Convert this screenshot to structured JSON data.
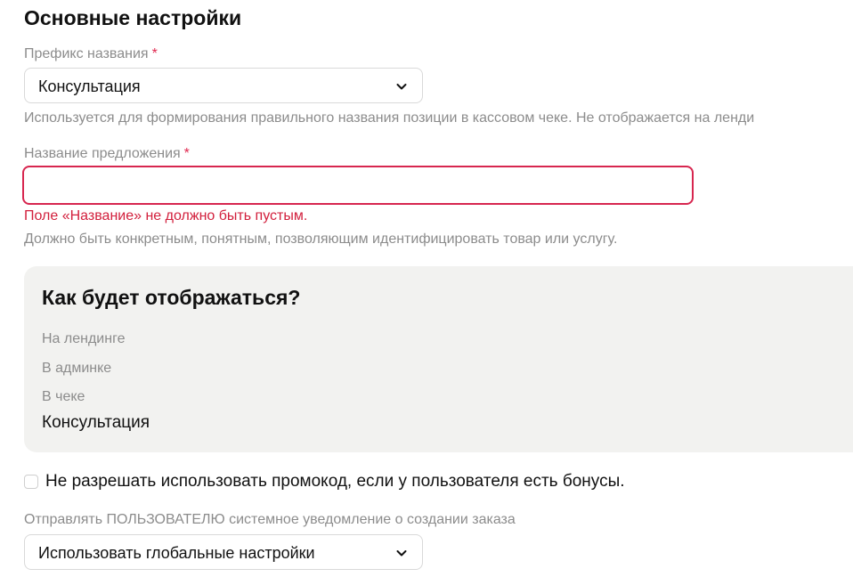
{
  "section": {
    "title": "Основные настройки"
  },
  "prefix_field": {
    "label": "Префикс названия",
    "required_mark": "*",
    "value": "Консультация",
    "hint": "Используется для формирования правильного названия позиции в кассовом чеке. Не отображается на ленди"
  },
  "name_field": {
    "label": "Название предложения",
    "required_mark": "*",
    "value": "",
    "placeholder": "",
    "error": "Поле «Название» не должно быть пустым.",
    "hint": "Должно быть конкретным, понятным, позволяющим идентифицировать товар или услугу."
  },
  "preview": {
    "title": "Как будет отображаться?",
    "landing_label": "На лендинге",
    "admin_label": "В админке",
    "receipt_label": "В чеке",
    "receipt_value": "Консультация"
  },
  "promo_checkbox": {
    "label": "Не разрешать использовать промокод, если у пользователя есть бонусы.",
    "checked": false
  },
  "notification_field": {
    "label": "Отправлять ПОЛЬЗОВАТЕЛЮ системное уведомление о создании заказа",
    "value": "Использовать глобальные настройки"
  },
  "icons": {
    "dropdown": "chevron-down-icon"
  },
  "colors": {
    "error": "#d21f3c",
    "required": "#e0284f",
    "panel_bg": "#f2f2f0",
    "muted_text": "#8c8c8c"
  }
}
